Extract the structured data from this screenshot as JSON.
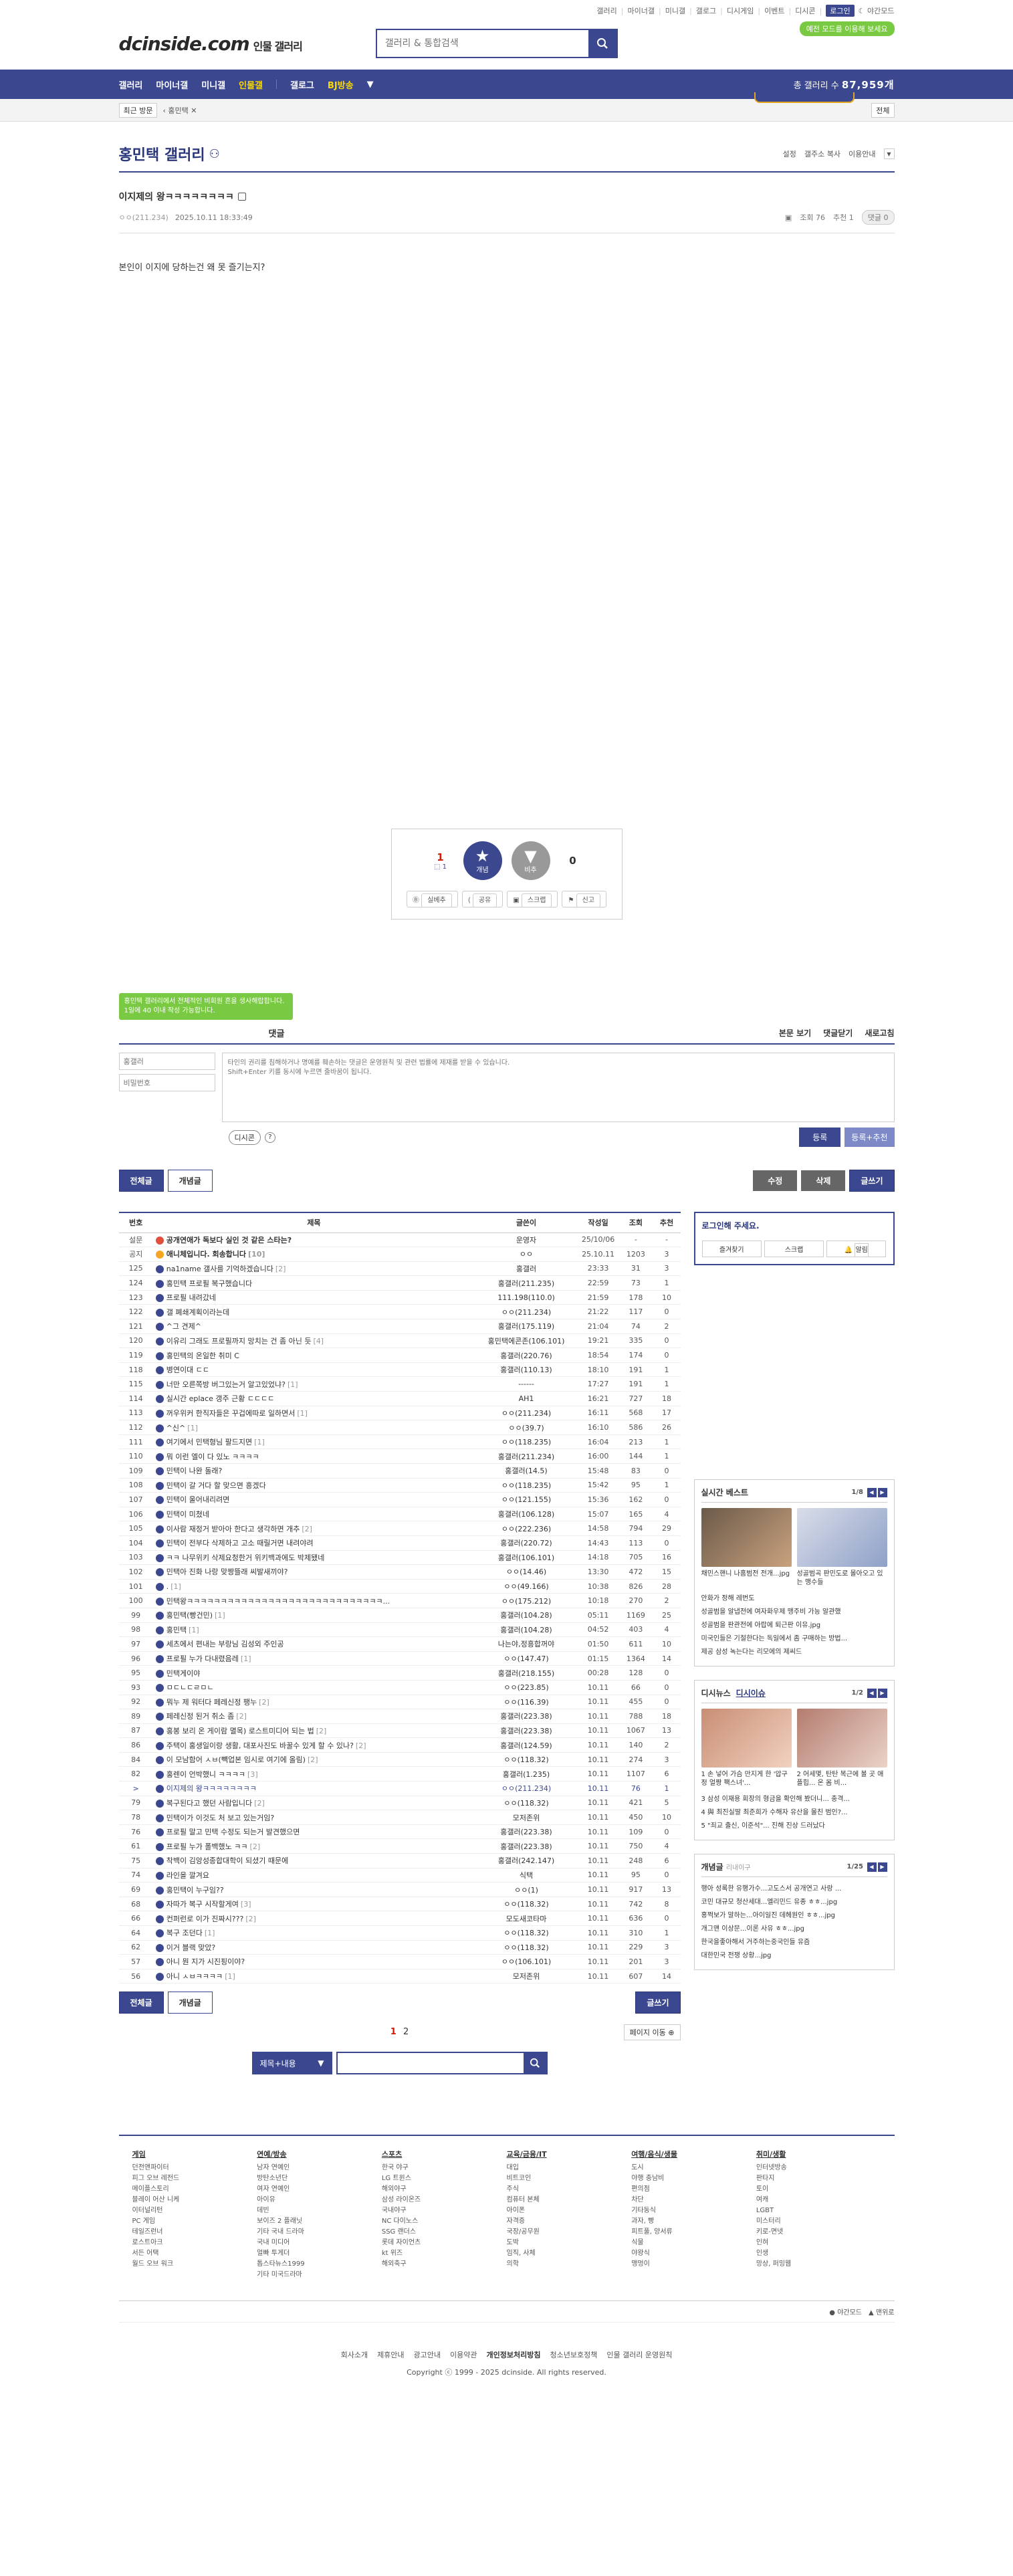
{
  "util": {
    "items": [
      "갤러리",
      "마이너갤",
      "미니갤",
      "갤로그",
      "디시게임",
      "이벤트",
      "디시콘"
    ],
    "login": "로그인",
    "darkmode": "야간모드",
    "dark_badge": "예전 모드를 이용해 보세요"
  },
  "header": {
    "logo": "dcinside.com",
    "logo_sub": "인물 갤러리",
    "search_placeholder": "갤러리 & 통합검색"
  },
  "gnb": {
    "items": [
      "갤러리",
      "마이너갤",
      "미니갤",
      "인물갤",
      "갤로그",
      "BJ방송"
    ],
    "count_label": "총 갤러리 수",
    "count": "87,959개"
  },
  "visit": {
    "btn": "최근 방문",
    "item": "홍민택",
    "all": "전체"
  },
  "gallery": {
    "title": "홍민택 갤러리",
    "opts": [
      "설정",
      "갤주소 복사",
      "이용안내"
    ]
  },
  "post": {
    "title": "이지제의 왕ㅋㅋㅋㅋㅋㅋㅋㅋ",
    "ip": "ㅇㅇ(211.234)",
    "date": "2025.10.11 18:33:49",
    "views": "조회 76",
    "reco": "추천 1",
    "comments": "댓글 0",
    "body": "본인이 이지에 당하는건 왜 못 즐기는지?"
  },
  "reco": {
    "up": "1",
    "up_sub": "1",
    "up_label": "개념",
    "down": "0",
    "down_label": "비추",
    "tools": [
      "실베추",
      "공유",
      "스크랩",
      "신고"
    ]
  },
  "comment": {
    "tooltip": "홍민택 갤러리에서 전체적인 비회원 흔을 생사해랍합니다. 1일에 40 이내 작성 가능합니다.",
    "label": "댓글",
    "right": [
      "본문 보기",
      "댓글닫기",
      "새로고침"
    ],
    "name_ph": "홍갤러",
    "pw_ph": "비밀번호",
    "textarea_ph": "타인의 권리를 침해하거나 명예를 훼손하는 댓글은 운영원칙 및 관련 법률에 제재를 받을 수 있습니다.\nShift+Enter 키를 동시에 누르면 줄바꿈이 됩니다.",
    "dccon": "디시콘",
    "reg": "등록",
    "reg2": "등록+추천"
  },
  "btns": {
    "all": "전체글",
    "concept": "개념글",
    "modify": "수정",
    "delete": "삭제",
    "write": "글쓰기"
  },
  "list": {
    "headers": [
      "번호",
      "제목",
      "글쓴이",
      "작성일",
      "조회",
      "추천"
    ],
    "rows": [
      {
        "num": "설문",
        "tit": "공개연애가 독보다 실인 것 같은 스타는?",
        "cnt": "",
        "wr": "운영자",
        "dt": "25/10/06",
        "vw": "-",
        "rc": "-",
        "t": "surv"
      },
      {
        "num": "공지",
        "tit": "애니체입니다. 회송합니다",
        "cnt": "[10]",
        "wr": "ㅇㅇ",
        "dt": "25.10.11",
        "vw": "1203",
        "rc": "3",
        "t": "notice"
      },
      {
        "num": "125",
        "tit": "na1name 갤사를 기억하겠습니다",
        "cnt": "[2]",
        "wr": "홍갤러",
        "dt": "23:33",
        "vw": "31",
        "rc": "3",
        "t": ""
      },
      {
        "num": "124",
        "tit": "홍민택 프로필 복구했습니다",
        "cnt": "",
        "wr": "홍갤러(211.235)",
        "dt": "22:59",
        "vw": "73",
        "rc": "1",
        "t": ""
      },
      {
        "num": "123",
        "tit": "프로필 내려갔네",
        "cnt": "",
        "wr": "111.198(110.0)",
        "dt": "21:59",
        "vw": "178",
        "rc": "10",
        "t": ""
      },
      {
        "num": "122",
        "tit": "갤 폐쇄계획이라는데",
        "cnt": "",
        "wr": "ㅇㅇ(211.234)",
        "dt": "21:22",
        "vw": "117",
        "rc": "0",
        "t": ""
      },
      {
        "num": "121",
        "tit": "^그 견제^",
        "cnt": "",
        "wr": "홍갤러(175.119)",
        "dt": "21:04",
        "vw": "74",
        "rc": "2",
        "t": ""
      },
      {
        "num": "120",
        "tit": "이유리 그래도 프로필까지 망치는 건 좀 아닌 듯",
        "cnt": "[4]",
        "wr": "홍민택에콘존(106.101)",
        "dt": "19:21",
        "vw": "335",
        "rc": "0",
        "t": ""
      },
      {
        "num": "119",
        "tit": "홍민택의 온일한 취미 C",
        "cnt": "",
        "wr": "홍갤러(220.76)",
        "dt": "18:54",
        "vw": "174",
        "rc": "0",
        "t": ""
      },
      {
        "num": "118",
        "tit": "병연이대 ㄷㄷ",
        "cnt": "",
        "wr": "홍갤러(110.13)",
        "dt": "18:10",
        "vw": "191",
        "rc": "1",
        "t": ""
      },
      {
        "num": "115",
        "tit": "너만 오른쪽방 버그있는거 알고있었냐?",
        "cnt": "[1]",
        "wr": "------",
        "dt": "17:27",
        "vw": "191",
        "rc": "1",
        "t": ""
      },
      {
        "num": "114",
        "tit": "실시간 eplace 갱주 근황 ㄷㄷㄷㄷ",
        "cnt": "",
        "wr": "AH1",
        "dt": "16:21",
        "vw": "727",
        "rc": "18",
        "t": ""
      },
      {
        "num": "113",
        "tit": "꺼우위커 한직자들은 꾸겁에따로 일하면서",
        "cnt": "[1]",
        "wr": "ㅇㅇ(211.234)",
        "dt": "16:11",
        "vw": "568",
        "rc": "17",
        "t": ""
      },
      {
        "num": "112",
        "tit": "^신^",
        "cnt": "[1]",
        "wr": "ㅇㅇ(39.7)",
        "dt": "16:10",
        "vw": "586",
        "rc": "26",
        "t": ""
      },
      {
        "num": "111",
        "tit": "여기에서 민택형님 팔드지면",
        "cnt": "[1]",
        "wr": "ㅇㅇ(118.235)",
        "dt": "16:04",
        "vw": "213",
        "rc": "1",
        "t": ""
      },
      {
        "num": "110",
        "tit": "뭐 이런 엘이 다 있노 ㅋㅋㅋㅋ",
        "cnt": "",
        "wr": "홍갤러(211.234)",
        "dt": "16:00",
        "vw": "144",
        "rc": "1",
        "t": ""
      },
      {
        "num": "109",
        "tit": "민택이 나완 돌래?",
        "cnt": "",
        "wr": "홍갤러(14.5)",
        "dt": "15:48",
        "vw": "83",
        "rc": "0",
        "t": ""
      },
      {
        "num": "108",
        "tit": "민택이 갈 거다 할 맞으면 흥겠다",
        "cnt": "",
        "wr": "ㅇㅇ(118.235)",
        "dt": "15:42",
        "vw": "95",
        "rc": "1",
        "t": ""
      },
      {
        "num": "107",
        "tit": "민택이 울어내리려면",
        "cnt": "",
        "wr": "ㅇㅇ(121.155)",
        "dt": "15:36",
        "vw": "162",
        "rc": "0",
        "t": ""
      },
      {
        "num": "106",
        "tit": "민택이 미쳤네",
        "cnt": "",
        "wr": "홍갤러(106.128)",
        "dt": "15:07",
        "vw": "165",
        "rc": "4",
        "t": ""
      },
      {
        "num": "105",
        "tit": "이사람 재정거 받아아 한다고 생각하면 개추",
        "cnt": "[2]",
        "wr": "ㅇㅇ(222.236)",
        "dt": "14:58",
        "vw": "794",
        "rc": "29",
        "t": ""
      },
      {
        "num": "104",
        "tit": "민택이 전부다 삭제하고 고소 때릴거면 내려야려",
        "cnt": "",
        "wr": "홍갤러(220.72)",
        "dt": "14:43",
        "vw": "113",
        "rc": "0",
        "t": ""
      },
      {
        "num": "103",
        "tit": "ㅋㅋ 나무위키 삭제요청한거 위키백과에도 박제됐네",
        "cnt": "",
        "wr": "홍갤러(106.101)",
        "dt": "14:18",
        "vw": "705",
        "rc": "16",
        "t": ""
      },
      {
        "num": "102",
        "tit": "민택아 진화 나랑 맞짱뜰래 씨발새끼야?",
        "cnt": "",
        "wr": "ㅇㅇ(14.46)",
        "dt": "13:30",
        "vw": "472",
        "rc": "15",
        "t": ""
      },
      {
        "num": "101",
        "tit": ".",
        "cnt": "[1]",
        "wr": "ㅇㅇ(49.166)",
        "dt": "10:38",
        "vw": "826",
        "rc": "28",
        "t": ""
      },
      {
        "num": "100",
        "tit": "민택왕ㅋㅋㅋㅋㅋㅋㅋㅋㅋㅋㅋㅋㅋㅋㅋㅋㅋㅋㅋㅋㅋㅋㅋㅋㅋㅋㅋㅋㅋ...",
        "cnt": "",
        "wr": "ㅇㅇ(175.212)",
        "dt": "10:18",
        "vw": "270",
        "rc": "2",
        "t": ""
      },
      {
        "num": "99",
        "tit": "홍민택(빵건민)",
        "cnt": "[1]",
        "wr": "홍갤러(104.28)",
        "dt": "05:11",
        "vw": "1169",
        "rc": "25",
        "t": ""
      },
      {
        "num": "98",
        "tit": "홍민택",
        "cnt": "[1]",
        "wr": "홍갤러(104.28)",
        "dt": "04:52",
        "vw": "403",
        "rc": "4",
        "t": ""
      },
      {
        "num": "97",
        "tit": "세츠에서 편내는 부랑님 김성외 주인공",
        "cnt": "",
        "wr": "나는야,정흥합꺼야",
        "dt": "01:50",
        "vw": "611",
        "rc": "10",
        "t": ""
      },
      {
        "num": "96",
        "tit": "프로필 누가 다내렸음레",
        "cnt": "[1]",
        "wr": "ㅇㅇ(147.47)",
        "dt": "01:15",
        "vw": "1364",
        "rc": "14",
        "t": ""
      },
      {
        "num": "95",
        "tit": "민택게이야",
        "cnt": "",
        "wr": "홍갤러(218.155)",
        "dt": "00:28",
        "vw": "128",
        "rc": "0",
        "t": ""
      },
      {
        "num": "93",
        "tit": "ㅁㄷㄴㄷㄹㅁㄴ",
        "cnt": "",
        "wr": "ㅇㅇ(223.85)",
        "dt": "10.11",
        "vw": "66",
        "rc": "0",
        "t": ""
      },
      {
        "num": "92",
        "tit": "뭐누 제 워터다 페레신정 팽누",
        "cnt": "[2]",
        "wr": "ㅇㅇ(116.39)",
        "dt": "10.11",
        "vw": "455",
        "rc": "0",
        "t": ""
      },
      {
        "num": "89",
        "tit": "페레신정 된거 취소 좀",
        "cnt": "[2]",
        "wr": "홍갤러(223.38)",
        "dt": "10.11",
        "vw": "788",
        "rc": "18",
        "t": ""
      },
      {
        "num": "87",
        "tit": "홍봉 보리 온 게이람 멸목) 로스트미디어 되는 법",
        "cnt": "[2]",
        "wr": "홍갤러(223.38)",
        "dt": "10.11",
        "vw": "1067",
        "rc": "13",
        "t": ""
      },
      {
        "num": "86",
        "tit": "주택이 홍생일이랑 생활, 대포사진도 바꿀수 있게 할 수 있나?",
        "cnt": "[2]",
        "wr": "홍갤러(124.59)",
        "dt": "10.11",
        "vw": "140",
        "rc": "2",
        "t": ""
      },
      {
        "num": "84",
        "tit": "이 모남함어 ㅅㅂ(빽업본 임시로 여기에 올림)",
        "cnt": "[2]",
        "wr": "ㅇㅇ(118.32)",
        "dt": "10.11",
        "vw": "274",
        "rc": "3",
        "t": ""
      },
      {
        "num": "82",
        "tit": "홍렌이 언박했니 ㅋㅋㅋㅋ",
        "cnt": "[3]",
        "wr": "홍갤러(1.235)",
        "dt": "10.11",
        "vw": "1107",
        "rc": "6",
        "t": ""
      },
      {
        "num": ">",
        "tit": "이지제의 왕ㅋㅋㅋㅋㅋㅋㅋㅋ",
        "cnt": "",
        "wr": "ㅇㅇ(211.234)",
        "dt": "10.11",
        "vw": "76",
        "rc": "1",
        "t": "cur"
      },
      {
        "num": "79",
        "tit": "복구된다고 했던 사람입니다",
        "cnt": "[2]",
        "wr": "ㅇㅇ(118.32)",
        "dt": "10.11",
        "vw": "421",
        "rc": "5",
        "t": ""
      },
      {
        "num": "78",
        "tit": "민택이가 이것도 처 보고 있는거임?",
        "cnt": "",
        "wr": "모저존위",
        "dt": "10.11",
        "vw": "450",
        "rc": "10",
        "t": ""
      },
      {
        "num": "76",
        "tit": "프로필 말고 민택 수정도 되는거 발견했으면",
        "cnt": "",
        "wr": "홍갤러(223.38)",
        "dt": "10.11",
        "vw": "109",
        "rc": "0",
        "t": ""
      },
      {
        "num": "61",
        "tit": "프로필 누가 폴백했노 ㅋㅋ",
        "cnt": "[2]",
        "wr": "홍갤러(223.38)",
        "dt": "10.11",
        "vw": "750",
        "rc": "4",
        "t": ""
      },
      {
        "num": "75",
        "tit": "착백이 김앙성종합대학이 되셨기 때문에",
        "cnt": "",
        "wr": "홍갤러(242.147)",
        "dt": "10.11",
        "vw": "248",
        "rc": "6",
        "t": ""
      },
      {
        "num": "74",
        "tit": "라인을 깔겨요",
        "cnt": "",
        "wr": "식택",
        "dt": "10.11",
        "vw": "95",
        "rc": "0",
        "t": ""
      },
      {
        "num": "69",
        "tit": "홍민택이 누구임??",
        "cnt": "",
        "wr": "ㅇㅇ(1)",
        "dt": "10.11",
        "vw": "917",
        "rc": "13",
        "t": ""
      },
      {
        "num": "68",
        "tit": "자따가 복구 시작할게여",
        "cnt": "[3]",
        "wr": "ㅇㅇ(118.32)",
        "dt": "10.11",
        "vw": "742",
        "rc": "8",
        "t": ""
      },
      {
        "num": "66",
        "tit": "컨퍼런로 이가 진짜시???",
        "cnt": "[2]",
        "wr": "모도새코타마",
        "dt": "10.11",
        "vw": "636",
        "rc": "0",
        "t": ""
      },
      {
        "num": "64",
        "tit": "복구 조던다",
        "cnt": "[1]",
        "wr": "ㅇㅇ(118.32)",
        "dt": "10.11",
        "vw": "310",
        "rc": "1",
        "t": ""
      },
      {
        "num": "62",
        "tit": "이거 블랙 맞았?",
        "cnt": "",
        "wr": "ㅇㅇ(118.32)",
        "dt": "10.11",
        "vw": "229",
        "rc": "3",
        "t": ""
      },
      {
        "num": "57",
        "tit": "아니 뭔 지가 시진핑이야?",
        "cnt": "",
        "wr": "ㅇㅇ(106.101)",
        "dt": "10.11",
        "vw": "201",
        "rc": "3",
        "t": ""
      },
      {
        "num": "56",
        "tit": "아니 ㅅㅂㅋㅋㅋㅋ",
        "cnt": "[1]",
        "wr": "모저존위",
        "dt": "10.11",
        "vw": "607",
        "rc": "14",
        "t": ""
      }
    ]
  },
  "side": {
    "login_title": "로그인해 주세요.",
    "login_btns": [
      "즐겨찾기",
      "스크랩",
      "알림"
    ],
    "best_title": "실시간 베스트",
    "best_page": "1/8",
    "best_caps": [
      "채민스핸니 나홈범전 전개...jpg",
      "성골범곡 판민도로 몰아오고 있는 맹수들"
    ],
    "best_list": [
      "안화가 정해 레번도",
      "성골범을 알냅전에 여자화우제 맹주비 가능 알관했",
      "성골범을 판관전에 아랍에 퇴근판 이유.jpg",
      "미국인들은 기절한다는 독일에서 좀 구매하는 방법...",
      "제공 삼성 녹는다는 리모에의 제씨드"
    ],
    "dcnews_tabs": [
      "디시뉴스",
      "디시이슈"
    ],
    "dcnews_page": "1/2",
    "dcnews_caps": [
      "1 손 넣어 가슴 만지게 한 '압구정 얼짱 팩스녀'...",
      "2 어세몇, 탄탄 복근에 볼 곳 애플힙... 온 몸 비..."
    ],
    "dcnews_list": [
      "3 삼성 이재용 회장의 형금을 확인해 봤더니... 충격...",
      "4 與 최진실딸 최준희가 수해자 유산을 몰친 범인?...",
      "5 \"죄교 출신, 이준석\"... 진해 진상 드러났다"
    ],
    "concept_title": "개념글",
    "concept_sub": "리내이구",
    "concept_page": "1/25",
    "concept_list": [
      "행아 성록한 유행가수...고도스서 공개연고 사랑 ...",
      "코민 대규모 청산세대...엘리민드 유종 ㅎㅎ...jpg",
      "홍쩍보가 말하는...아이일진 데헤원인 ㅎㅎ...jpg",
      "개그맨 이상문...이론 사유 ㅎㅎ...jpg",
      "한국을좋아해서 거주하는중국인들 유즘",
      "대한민국 전쟁 상황...jpg"
    ]
  },
  "pager": {
    "p1": "1",
    "p2": "2",
    "jump": "페이지 이동"
  },
  "bsearch": {
    "sel": "제목+내용"
  },
  "fcats": [
    {
      "h": "게임",
      "items": [
        "던전앤파이터",
        "피그 오브 레전드",
        "메이플스토리",
        "블레이 어산 니케",
        "이터널리턴",
        "PC 게임",
        "테일즈런너",
        "로스트아크",
        "서든 어택",
        "월드 오브 워크"
      ]
    },
    {
      "h": "연예/방송",
      "items": [
        "남자 연예인",
        "방탄소년단",
        "여자 연예인",
        "아이유",
        "데빈",
        "보이즈 2 플래닛",
        "기타 국내 드라마",
        "국내 미디어",
        "얼빠 투게더",
        "톱스타뉴스1999",
        "기타 미국드라마"
      ]
    },
    {
      "h": "스포츠",
      "items": [
        "한국 야구",
        "LG 트윈스",
        "해외야구",
        "삼성 라이온즈",
        "국내야구",
        "NC 다이노스",
        "SSG 랜더스",
        "롯데 자이언츠",
        "kt 위즈",
        "해외축구"
      ]
    },
    {
      "h": "교육/금융/IT",
      "items": [
        "대입",
        "비트코인",
        "주식",
        "컴퓨터 본체",
        "아이폰",
        "자격증",
        "국장/공무원",
        "도박",
        "임직, 사체",
        "의학"
      ]
    },
    {
      "h": "여행/음식/생물",
      "items": [
        "도시",
        "야행 충남비",
        "편의점",
        "차단",
        "기타동식",
        "과자, 빵",
        "피트풀, 양서류",
        "식물",
        "야왕식",
        "맹멍이"
      ]
    },
    {
      "h": "취미/생활",
      "items": [
        "인터넷방송",
        "판타지",
        "토이",
        "여캐",
        "LGBT",
        "미스터리",
        "키로-면넷",
        "인혀",
        "인생",
        "망상, 퍼밍웹"
      ]
    }
  ],
  "flinks": [
    "야간모드",
    "맨위로"
  ],
  "footer": {
    "links": [
      "회사소개",
      "제휴안내",
      "광고안내",
      "이용약관",
      "개인정보처리방침",
      "청소년보호정책",
      "인물 갤러리 운영원칙"
    ],
    "copy": "Copyright ⓒ 1999 - 2025 dcinside. All rights reserved."
  }
}
